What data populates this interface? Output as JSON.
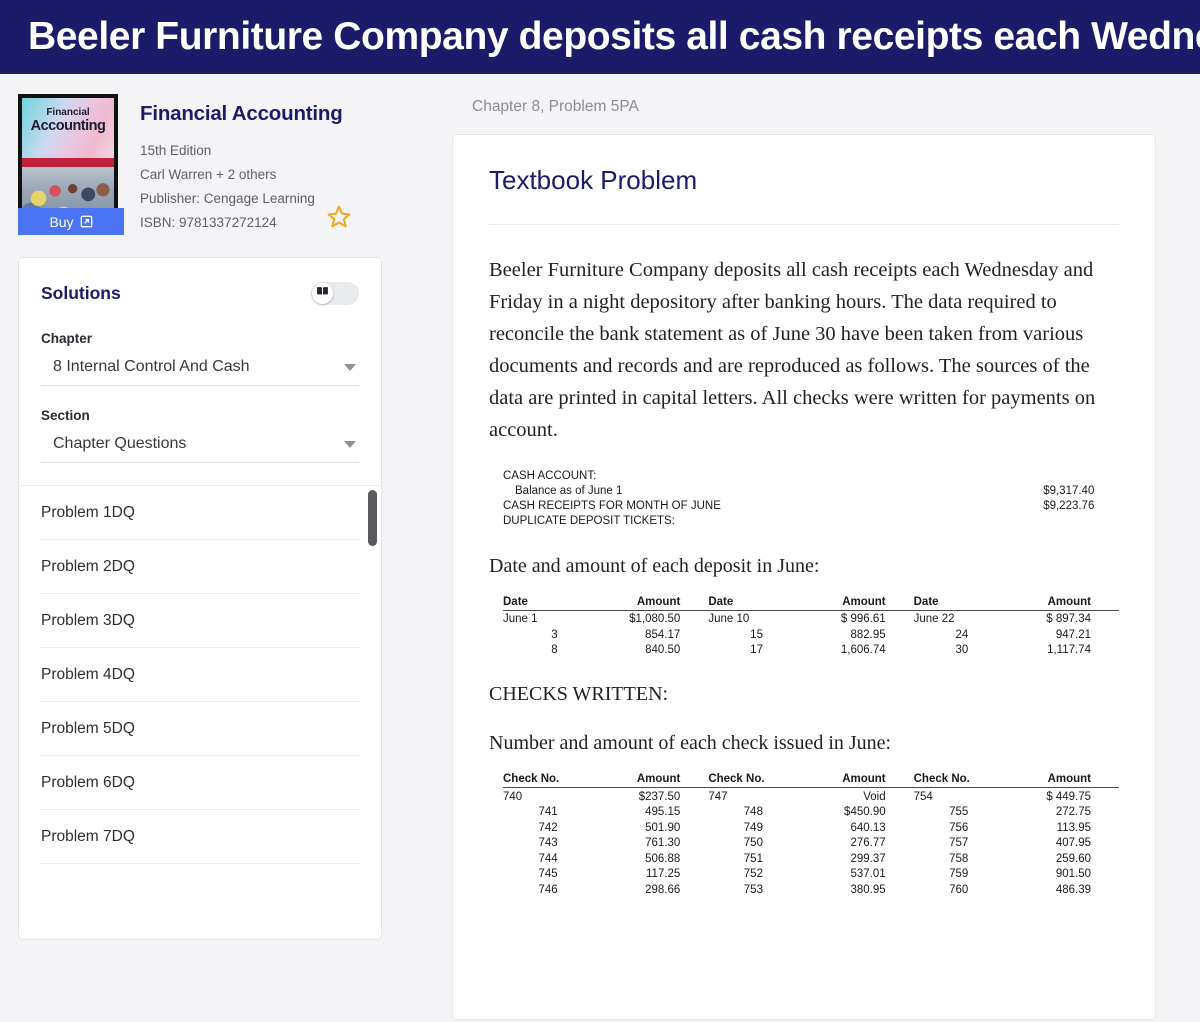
{
  "banner": {
    "title": "Beeler Furniture Company deposits all cash receipts each Wednesday and"
  },
  "book": {
    "title": "Financial Accounting",
    "cover_title_small": "Financial",
    "cover_title_big": "Accounting",
    "edition": "15th Edition",
    "authors": "Carl Warren + 2 others",
    "publisher": "Publisher: Cengage Learning",
    "isbn": "ISBN: 9781337272124",
    "buy_label": "Buy",
    "buy_color": "#4a74f3",
    "title_color": "#1b1b69",
    "star_color": "#f5a623"
  },
  "solutions": {
    "title": "Solutions",
    "toggle_on": false,
    "chapter_label": "Chapter",
    "chapter_value": "8 Internal Control And Cash",
    "section_label": "Section",
    "section_value": "Chapter Questions",
    "items": [
      {
        "label": "Problem 1DQ"
      },
      {
        "label": "Problem 2DQ"
      },
      {
        "label": "Problem 3DQ"
      },
      {
        "label": "Problem 4DQ"
      },
      {
        "label": "Problem 5DQ"
      },
      {
        "label": "Problem 6DQ"
      },
      {
        "label": "Problem 7DQ"
      }
    ]
  },
  "main": {
    "breadcrumb": "Chapter 8, Problem 5PA",
    "card_title": "Textbook Problem",
    "paragraph": "Beeler Furniture Company deposits all cash receipts each Wednesday and Friday in a night depository after banking hours. The data required to reconcile the bank statement as of June 30 have been taken from various documents and records and are reproduced as follows. The sources of the data are printed in capital letters. All checks were written for payments on account.",
    "cash_account": {
      "heading": "CASH ACCOUNT:",
      "rows": [
        {
          "label": "Balance as of June 1",
          "indent": true,
          "amount": "$9,317.40"
        },
        {
          "label": "CASH RECEIPTS FOR MONTH OF JUNE",
          "indent": false,
          "amount": "$9,223.76"
        },
        {
          "label": "DUPLICATE DEPOSIT TICKETS:",
          "indent": false,
          "amount": ""
        }
      ]
    },
    "deposits_heading": "Date and amount of each deposit in June:",
    "deposits_table": {
      "headers": [
        "Date",
        "Amount",
        "Date",
        "Amount",
        "Date",
        "Amount"
      ],
      "rows": [
        [
          "June 1",
          "$1,080.50",
          "June 10",
          "$  996.61",
          "June 22",
          "$  897.34"
        ],
        [
          "3",
          "854.17",
          "15",
          "882.95",
          "24",
          "947.21"
        ],
        [
          "8",
          "840.50",
          "17",
          "1,606.74",
          "30",
          "1,117.74"
        ]
      ]
    },
    "checks_written_heading": "CHECKS WRITTEN:",
    "checks_heading": "Number and amount of each check issued in June:",
    "checks_table": {
      "headers": [
        "Check No.",
        "Amount",
        "Check No.",
        "Amount",
        "Check No.",
        "Amount"
      ],
      "rows": [
        [
          "740",
          "$237.50",
          "747",
          "Void",
          "754",
          "$  449.75"
        ],
        [
          "741",
          "495.15",
          "748",
          "$450.90",
          "755",
          "272.75"
        ],
        [
          "742",
          "501.90",
          "749",
          "640.13",
          "756",
          "113.95"
        ],
        [
          "743",
          "761.30",
          "750",
          "276.77",
          "757",
          "407.95"
        ],
        [
          "744",
          "506.88",
          "751",
          "299.37",
          "758",
          "259.60"
        ],
        [
          "745",
          "117.25",
          "752",
          "537.01",
          "759",
          "901.50"
        ],
        [
          "746",
          "298.66",
          "753",
          "380.95",
          "760",
          "486.39"
        ]
      ]
    }
  }
}
